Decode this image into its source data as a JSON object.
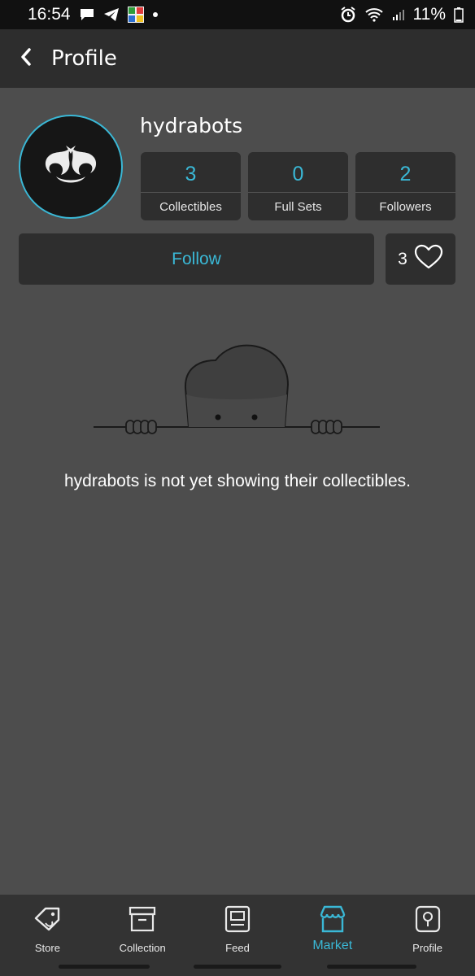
{
  "status_bar": {
    "time": "16:54",
    "battery": "11%",
    "left_icons": [
      "message-icon",
      "telegram-icon",
      "game-app-icon",
      "dot-icon"
    ],
    "right_icons": [
      "alarm-icon",
      "wifi-icon",
      "signal-icon",
      "battery-icon"
    ]
  },
  "app_bar": {
    "title": "Profile",
    "back_icon": "chevron-left-icon"
  },
  "profile": {
    "username": "hydrabots",
    "stats": [
      {
        "value": "3",
        "label": "Collectibles"
      },
      {
        "value": "0",
        "label": "Full Sets"
      },
      {
        "value": "2",
        "label": "Followers"
      }
    ],
    "follow_label": "Follow",
    "likes_count": "3"
  },
  "empty_state": {
    "message": "hydrabots is not yet showing their collectibles."
  },
  "bottom_nav": {
    "items": [
      {
        "label": "Store",
        "icon": "tag-icon",
        "active": false
      },
      {
        "label": "Collection",
        "icon": "archive-box-icon",
        "active": false
      },
      {
        "label": "Feed",
        "icon": "feed-card-icon",
        "active": false
      },
      {
        "label": "Market",
        "icon": "storefront-icon",
        "active": true
      },
      {
        "label": "Profile",
        "icon": "profile-pin-icon",
        "active": false
      }
    ]
  },
  "colors": {
    "accent": "#3ab8d6",
    "background": "#4d4d4d",
    "card": "#2e2e2e",
    "app_bar": "#2d2d2d",
    "status_bar": "#111111"
  }
}
